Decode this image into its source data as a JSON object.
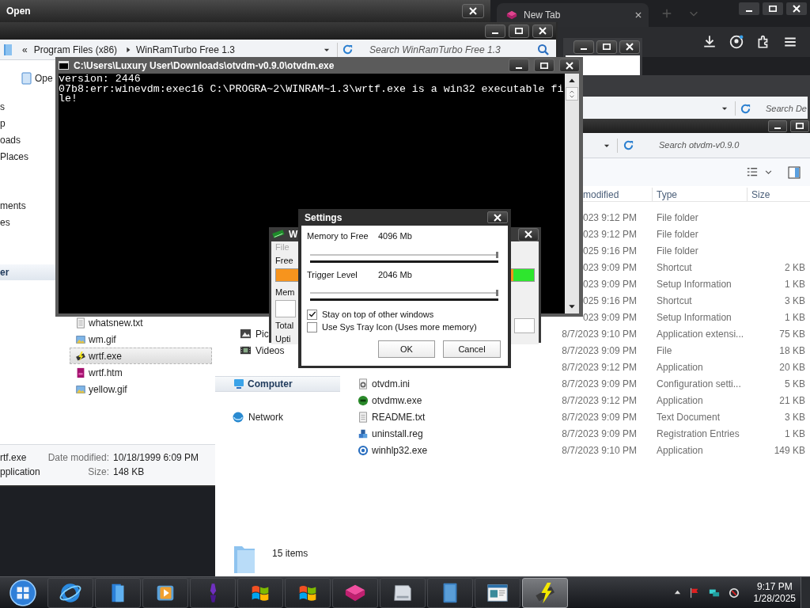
{
  "open_dialog": {
    "title": "Open"
  },
  "browser": {
    "tab": {
      "title": "New Tab"
    }
  },
  "back_window": {
    "search": {
      "placeholder": "Search De"
    }
  },
  "folder_window": {
    "breadcrumb": [
      "«",
      "Program Files (x86)",
      "WinRamTurbo Free 1.3"
    ],
    "search": {
      "placeholder": "Search WinRamTurbo Free 1.3"
    },
    "nav_groups": [
      [
        "Ope"
      ],
      [
        "s",
        "p",
        "oads",
        "Places"
      ],
      [
        "ments",
        "es"
      ]
    ],
    "nav_header": "er",
    "files": [
      {
        "name": "whatsnew.txt",
        "kind": "text",
        "selected": false
      },
      {
        "name": "wm.gif",
        "kind": "image",
        "selected": false
      },
      {
        "name": "wrtf.exe",
        "kind": "app",
        "selected": true
      },
      {
        "name": "wrtf.htm",
        "kind": "web",
        "selected": false
      },
      {
        "name": "yellow.gif",
        "kind": "image",
        "selected": false
      }
    ],
    "details": {
      "name": "rtf.exe",
      "type": "pplication",
      "fields": [
        {
          "label": "Date modified:",
          "value": "10/18/1999 6:09 PM"
        },
        {
          "label": "Size:",
          "value": "148 KB"
        }
      ]
    }
  },
  "explorer": {
    "search": {
      "placeholder": "Search otvdm-v0.9.0"
    },
    "columns": [
      "modified",
      "Type",
      "Size"
    ],
    "nav": [
      {
        "label": "Pic",
        "kind": "pictures"
      },
      {
        "label": "Videos",
        "kind": "videos"
      }
    ],
    "nav_header": "Computer",
    "network": "Network",
    "rows": [
      {
        "modified": "023 9:12 PM",
        "type": "File folder"
      },
      {
        "modified": "023 9:12 PM",
        "type": "File folder"
      },
      {
        "modified": "025 9:16 PM",
        "type": "File folder"
      },
      {
        "modified": "023 9:09 PM",
        "type": "Shortcut",
        "size": "2 KB"
      },
      {
        "modified": "023 9:09 PM",
        "type": "Setup Information",
        "size": "1 KB"
      },
      {
        "modified": "025 9:16 PM",
        "type": "Shortcut",
        "size": "3 KB"
      },
      {
        "modified": "023 9:09 PM",
        "type": "Setup Information",
        "size": "1 KB"
      },
      {
        "modified": "8/7/2023 9:10 PM",
        "type": "Application extensi...",
        "size": "75 KB"
      },
      {
        "modified": "8/7/2023 9:09 PM",
        "type": "File",
        "size": "18 KB"
      },
      {
        "modified": "8/7/2023 9:12 PM",
        "type": "Application",
        "size": "20 KB"
      },
      {
        "name": "otvdm.ini",
        "kind": "settings",
        "modified": "8/7/2023 9:09 PM",
        "type": "Configuration setti...",
        "size": "5 KB"
      },
      {
        "name": "otvdmw.exe",
        "kind": "app",
        "modified": "8/7/2023 9:12 PM",
        "type": "Application",
        "size": "21 KB"
      },
      {
        "name": "README.txt",
        "kind": "text",
        "modified": "8/7/2023 9:09 PM",
        "type": "Text Document",
        "size": "3 KB"
      },
      {
        "name": "uninstall.reg",
        "kind": "registry",
        "modified": "8/7/2023 9:09 PM",
        "type": "Registration Entries",
        "size": "1 KB"
      },
      {
        "name": "winhlp32.exe",
        "kind": "help",
        "modified": "8/7/2023 9:10 PM",
        "type": "Application",
        "size": "149 KB"
      }
    ],
    "status": "15 items"
  },
  "console": {
    "title": "C:\\Users\\Luxury User\\Downloads\\otvdm-v0.9.0\\otvdm.exe",
    "lines": [
      "version: 2446",
      "07b8:err:winevdm:exec16 C:\\PROGRA~2\\WINRAM~1.3\\wrtf.exe is a win32 executable fi",
      "le!"
    ]
  },
  "winramturbo": {
    "title": "W",
    "menu": "File",
    "labels": [
      "Free",
      "Mem",
      "Total",
      "Upti"
    ]
  },
  "settings": {
    "title": "Settings",
    "sliders": [
      {
        "label": "Memory to Free",
        "reading": "4096 Mb",
        "level": 1
      },
      {
        "label": "Trigger Level",
        "reading": "2046 Mb",
        "level": 1
      }
    ],
    "checkboxes": [
      {
        "label": "Stay on top of other windows",
        "checked": true
      },
      {
        "label": "Use Sys Tray Icon (Uses more memory)",
        "checked": false
      }
    ],
    "buttons": [
      "OK",
      "Cancel"
    ]
  },
  "taskbar": {
    "apps": [
      {
        "kind": "browser",
        "selected": false
      },
      {
        "kind": "folder",
        "selected": false
      },
      {
        "kind": "media",
        "selected": false
      },
      {
        "kind": "pen",
        "selected": false
      },
      {
        "kind": "flag",
        "selected": false
      },
      {
        "kind": "flag",
        "selected": false
      },
      {
        "kind": "box",
        "selected": false
      },
      {
        "kind": "drive",
        "selected": false
      },
      {
        "kind": "book",
        "selected": false
      },
      {
        "kind": "window",
        "selected": false
      },
      {
        "kind": "ram",
        "selected": true
      }
    ],
    "clock": {
      "time": "9:17 PM",
      "date": "1/28/2025"
    }
  }
}
